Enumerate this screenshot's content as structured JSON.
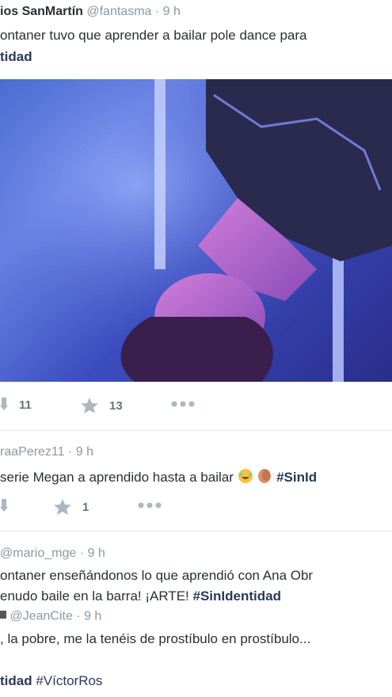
{
  "tweet1": {
    "name": "ios SanMartín",
    "handle": "@fantasma",
    "dot": "·",
    "time": "9 h",
    "text_line1": "ontaner tuvo que aprender a bailar pole dance para",
    "text_line2": "tidad",
    "retweets": "11",
    "favorites": "13"
  },
  "tweet2": {
    "handle": "raaPerez11",
    "dot": "·",
    "time": "9 h",
    "text": "serie Megan a aprendido hasta a bailar",
    "hashtag": "#SinId",
    "favorites": "1"
  },
  "tweet3": {
    "handle": "@mario_mge",
    "dot": "·",
    "time": "9 h",
    "text_line1": "ontaner enseñándonos lo que aprendió con Ana Obr",
    "text_line2": "enudo baile en la barra! ¡ARTE!",
    "hashtag": "#SinIdentidad"
  },
  "tweet4": {
    "handle": "@JeanCite",
    "dot": "·",
    "time": "9 h",
    "text_line1": ", la pobre, me la tenéis de prostíbulo en prostíbulo...",
    "text_line2_bold": "tidad",
    "text_line2_hashtag": "#VíctorRos"
  },
  "colors": {
    "hashtag": "#2b3a5a",
    "meta": "#8899a6",
    "action": "#66757f",
    "divider": "#e1e8ed"
  }
}
